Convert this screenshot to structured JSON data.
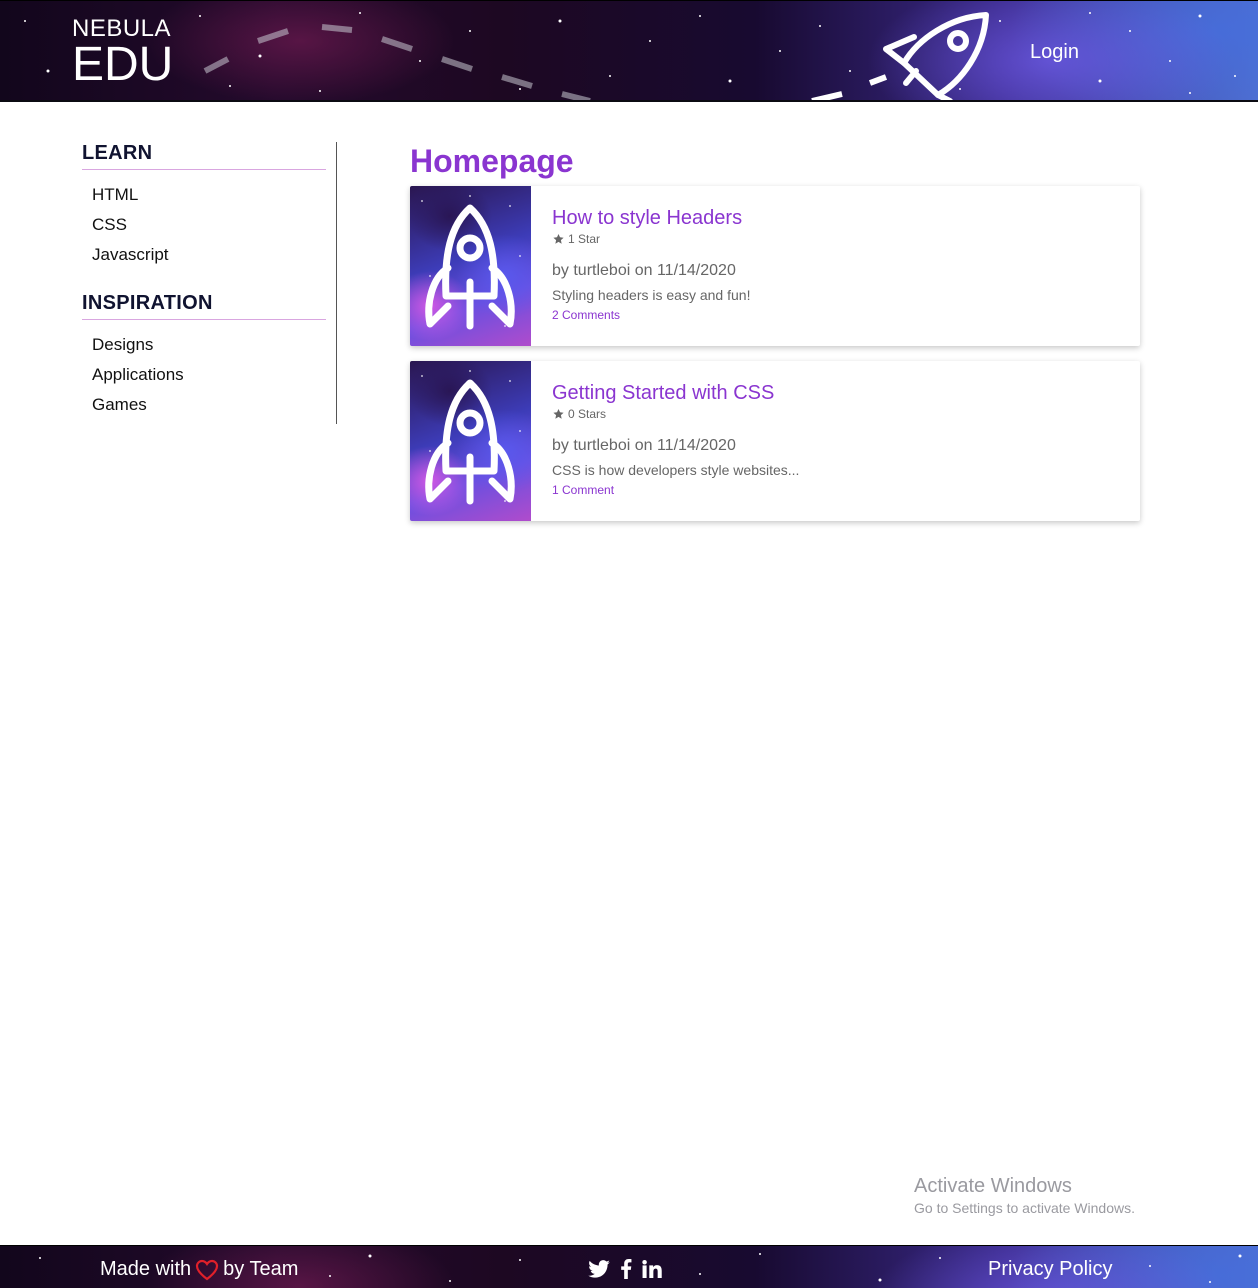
{
  "header": {
    "logo_top": "NEBULA",
    "logo_bottom": "EDU",
    "login_label": "Login"
  },
  "sidebar": {
    "sections": [
      {
        "title": "LEARN",
        "items": [
          "HTML",
          "CSS",
          "Javascript"
        ]
      },
      {
        "title": "INSPIRATION",
        "items": [
          "Designs",
          "Applications",
          "Games"
        ]
      }
    ]
  },
  "main": {
    "title": "Homepage",
    "posts": [
      {
        "title": "How to style Headers",
        "stars": "1 Star",
        "byline": "by turtleboi on 11/14/2020",
        "excerpt": "Styling headers is easy and fun!",
        "comments": "2 Comments"
      },
      {
        "title": "Getting Started with CSS",
        "stars": "0 Stars",
        "byline": "by turtleboi on 11/14/2020",
        "excerpt": "CSS is how developers style websites...",
        "comments": "1 Comment"
      }
    ]
  },
  "watermark": {
    "title": "Activate Windows",
    "subtitle": "Go to Settings to activate Windows."
  },
  "footer": {
    "made_prefix": "Made with",
    "made_suffix": "by Team",
    "privacy_label": "Privacy Policy",
    "social_icons": [
      "twitter-icon",
      "facebook-icon",
      "linkedin-icon"
    ]
  },
  "colors": {
    "accent": "#8a35d0",
    "heading": "#101330",
    "muted": "#666666",
    "divider": "#d9a6e0",
    "heart": "#e0202a"
  },
  "icons": [
    "rocket-icon",
    "star-icon",
    "heart-icon"
  ]
}
